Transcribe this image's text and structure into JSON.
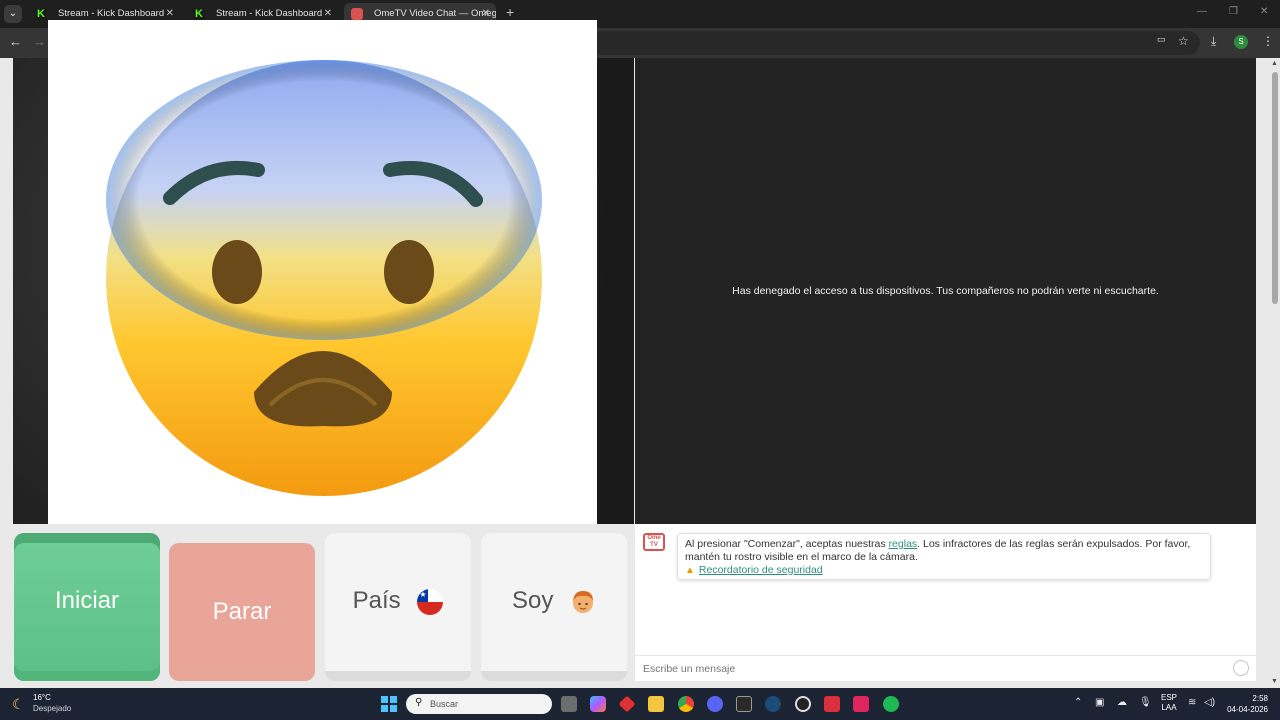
{
  "browser": {
    "tabs": [
      {
        "title": "Stream - Kick Dashboard",
        "favicon": "kick-icon"
      },
      {
        "title": "Stream - Kick Dashboard",
        "favicon": "kick-icon"
      },
      {
        "title": "OmeTV Video Chat — Omegle",
        "favicon": "ometv-icon"
      }
    ],
    "profile_initial": "S"
  },
  "video": {
    "denied_message": "Has denegado el acceso a tus dispositivos. Tus compañeros no podrán verte ni escucharte."
  },
  "controls": {
    "start_label": "Iniciar",
    "stop_label": "Parar",
    "country_label": "País",
    "me_label": "Soy"
  },
  "chat": {
    "logo_text": "Ome TV",
    "notice_before": "Al presionar \"Comenzar\", aceptas nuestras ",
    "notice_link": "reglas",
    "notice_after": ". Los infractores de las reglas serán expulsados. Por favor, mantén tu rostro visible en el marco de la cámara.",
    "safety_link": "Recordatorio de seguridad",
    "input_placeholder": "Escribe un mensaje"
  },
  "taskbar": {
    "temperature": "16°C",
    "weather": "Despejado",
    "search_placeholder": "Buscar",
    "lang_top": "ESP",
    "lang_bottom": "LAA",
    "time": "2:58",
    "date": "04-04-2026"
  },
  "colors": {
    "start": "#6fcf97",
    "stop": "#e8a598",
    "link": "#2f8f7f"
  }
}
